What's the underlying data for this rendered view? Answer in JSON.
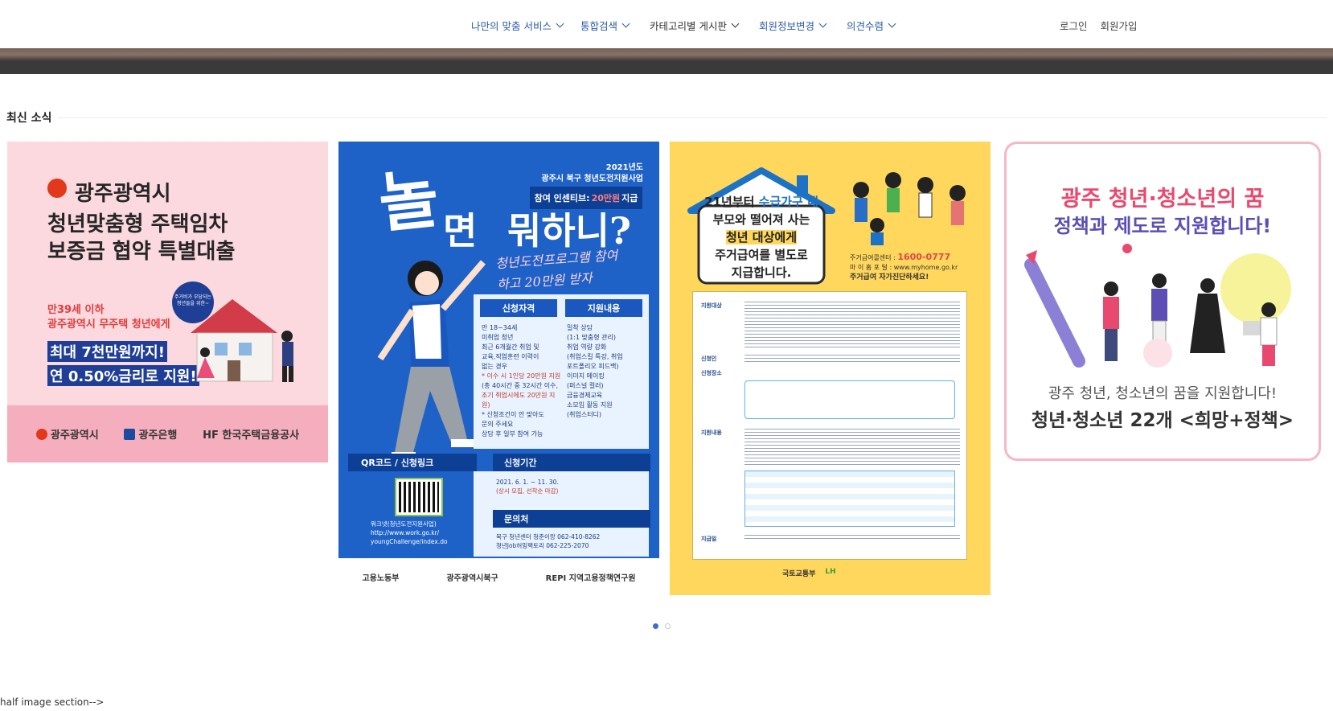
{
  "nav": {
    "items": [
      {
        "label": "나만의 맞춤 서비스",
        "color": "blue"
      },
      {
        "label": "통합검색",
        "color": "blue"
      },
      {
        "label": "카테고리별 게시판",
        "color": "dark"
      },
      {
        "label": "회원정보변경",
        "color": "blue"
      },
      {
        "label": "의견수렴",
        "color": "blue"
      }
    ],
    "login": "로그인",
    "signup": "회원가입"
  },
  "section": {
    "title": "최신 소식"
  },
  "cards": {
    "c1": {
      "title1": "광주광역시",
      "title2": "청년맞춤형 주택임차",
      "title3": "보증금 협약 특별대출",
      "sub1": "만39세 이하",
      "sub2": "광주광역시 무주택 청년에게",
      "hl1": "최대 7천만원까지!",
      "hl2": "연 0.50%금리로 지원!",
      "bubble": "주거비가 부담되는 청년들을 위한~",
      "footer": [
        "광주광역시",
        "광주은행",
        "HF 한국주택금융공사"
      ]
    },
    "c2": {
      "big1": "놀",
      "big2": "면",
      "big3": "뭐하니?",
      "year": "2021년도",
      "program": "광주시 북구 청년도전지원사업",
      "pill_prefix": "참여 인센티브:",
      "pill_amount": "20만원",
      "pill_suffix": "지급",
      "script1": "청년도전프로그램 참여",
      "script2": "하고 20만원 받자",
      "qual_hd": "신청자격",
      "support_hd": "지원내용",
      "qual_lines": [
        "만 18~34세",
        "미취업 청년",
        "최근 6개월간 취업 및",
        "교육,직업훈련 이력이",
        "없는 경우",
        "* 이수 시 1인당 20만원 지원",
        "(총 40시간 중 32시간 이수,",
        "조기 취업시에도 20만원 지원)",
        "* 신청조건이 안 맞아도",
        "문의 주세요",
        "상담 후 일부 참여 가능"
      ],
      "support_lines": [
        "밀착 상담",
        "(1:1 맞춤형 관리)",
        "취업 역량 강화",
        "(취업스킬 특강, 취업",
        "포트폴리오 피드백)",
        "이미지 메이킹",
        "(퍼스널 컬러)",
        "금융경제교육",
        "소모임 활동 지원",
        "(취업스터디)"
      ],
      "qr_label": "QR코드 / 신청링크",
      "period_label": "신청기간",
      "period_value": "2021. 6. 1. ~ 11. 30.",
      "period_note": "(상시 모집, 선착순 마감)",
      "inq_label": "문의처",
      "inq1": "북구 청년센터 청춘이랑 062-410-8262",
      "inq2": "청년Job허밍팩토리 062-225-2070",
      "link1": "워크넷(청년도전지원사업)",
      "link2": "http://www.work.go.kr/",
      "link3": "youngChallenge/index.do",
      "bottom": [
        "고용노동부",
        "광주광역시북구",
        "REPI 지역고용정책연구원"
      ]
    },
    "c3": {
      "line1a": "21년부터",
      "line1b": "수급가구 내",
      "line2": "부모와 떨어져 사는",
      "line3": "청년 대상에게",
      "line4": "주거급여를 별도로",
      "line5": "지급합니다.",
      "contact_label": "주거급여콜센터 :",
      "contact_num": "1600-0777",
      "contact_web": "마 이 홈 포 털 : www.myhome.go.kr",
      "contact_cta": "주거급여 자가진단하세요!",
      "rows": [
        "지원대상",
        "신청인",
        "신청장소",
        "지원내용",
        "지급일"
      ],
      "logos": [
        "국토교통부",
        "LH"
      ]
    },
    "c4": {
      "head1": "광주 청년·청소년의 꿈",
      "head2": "정책과 제도로 지원합니다!",
      "desc": "광주 청년, 청소년의 꿈을 지원합니다!",
      "desc2": "청년·청소년 22개 <희망+정책>"
    }
  },
  "carousel": {
    "dots": 2,
    "active": 0
  },
  "footer_comment": "half image section-->",
  "colors": {
    "nav_blue": "#2a5aa8",
    "card1_bg": "#fbd9de",
    "card2_bg": "#1e62c8",
    "card3_bg": "#ffd75c",
    "card4_border": "#f6b7c5"
  }
}
